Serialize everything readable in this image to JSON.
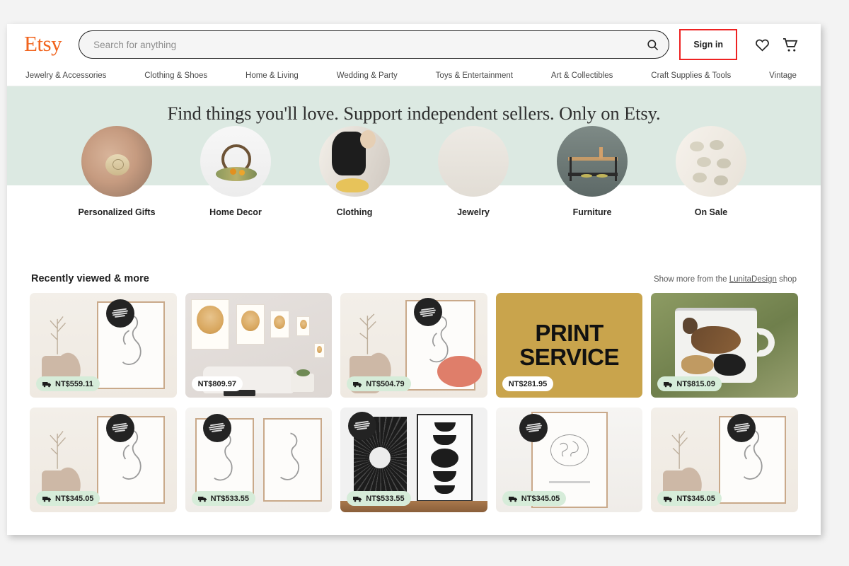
{
  "header": {
    "logo": "Etsy",
    "search_placeholder": "Search for anything",
    "search_value": "",
    "search_icon": "search-icon",
    "signin_label": "Sign in",
    "favorites_icon": "heart-icon",
    "cart_icon": "cart-icon",
    "highlight_color": "#ee2222"
  },
  "nav": {
    "items": [
      {
        "label": "Jewelry & Accessories"
      },
      {
        "label": "Clothing & Shoes"
      },
      {
        "label": "Home & Living"
      },
      {
        "label": "Wedding & Party"
      },
      {
        "label": "Toys & Entertainment"
      },
      {
        "label": "Art & Collectibles"
      },
      {
        "label": "Craft Supplies & Tools"
      },
      {
        "label": "Vintage"
      }
    ]
  },
  "hero": {
    "title": "Find things you'll love. Support independent sellers. Only on Etsy.",
    "background_color": "#dce9e2"
  },
  "categories": [
    {
      "label": "Personalized Gifts",
      "image": "engraved-pendant-photo"
    },
    {
      "label": "Home Decor",
      "image": "dried-flower-wreath-photo"
    },
    {
      "label": "Clothing",
      "image": "woman-in-black-dress-photo"
    },
    {
      "label": "Jewelry",
      "image": "gold-ring-photo"
    },
    {
      "label": "Furniture",
      "image": "console-table-photo"
    },
    {
      "label": "On Sale",
      "image": "ceramic-dishes-photo"
    }
  ],
  "recently_viewed": {
    "title": "Recently viewed & more",
    "show_more_prefix": "Show more from the",
    "show_more_shop": "LunitaDesign",
    "show_more_suffix": "shop",
    "items": [
      {
        "price": "NT$559.11",
        "free_shipping": true,
        "badge": "print-on-demand-sticker",
        "image": "line-art-print-with-vase-photo"
      },
      {
        "price": "NT$809.97",
        "free_shipping": false,
        "badge": "",
        "image": "pet-portrait-wall-sizes-photo"
      },
      {
        "price": "NT$504.79",
        "free_shipping": true,
        "badge": "print-on-demand-sticker",
        "image": "line-art-print-with-dried-flowers-photo"
      },
      {
        "price": "NT$281.95",
        "free_shipping": false,
        "badge": "",
        "image": "print-service-gold-banner"
      },
      {
        "price": "NT$815.09",
        "free_shipping": true,
        "badge": "",
        "image": "pangolin-enamel-mug-photo"
      },
      {
        "price": "NT$345.05",
        "free_shipping": true,
        "badge": "print-on-demand-sticker",
        "image": "line-art-print-with-vase-photo"
      },
      {
        "price": "NT$533.55",
        "free_shipping": true,
        "badge": "print-on-demand-sticker",
        "image": "two-line-art-prints-photo"
      },
      {
        "price": "NT$533.55",
        "free_shipping": true,
        "badge": "print-on-demand-sticker",
        "image": "sunburst-and-moon-phase-prints-photo"
      },
      {
        "price": "NT$345.05",
        "free_shipping": true,
        "badge": "print-on-demand-sticker",
        "image": "globe-line-art-print-photo"
      },
      {
        "price": "NT$345.05",
        "free_shipping": true,
        "badge": "print-on-demand-sticker",
        "image": "line-art-print-with-vase-photo"
      }
    ],
    "print_service_text_line1": "PRINT",
    "print_service_text_line2": "SERVICE"
  }
}
